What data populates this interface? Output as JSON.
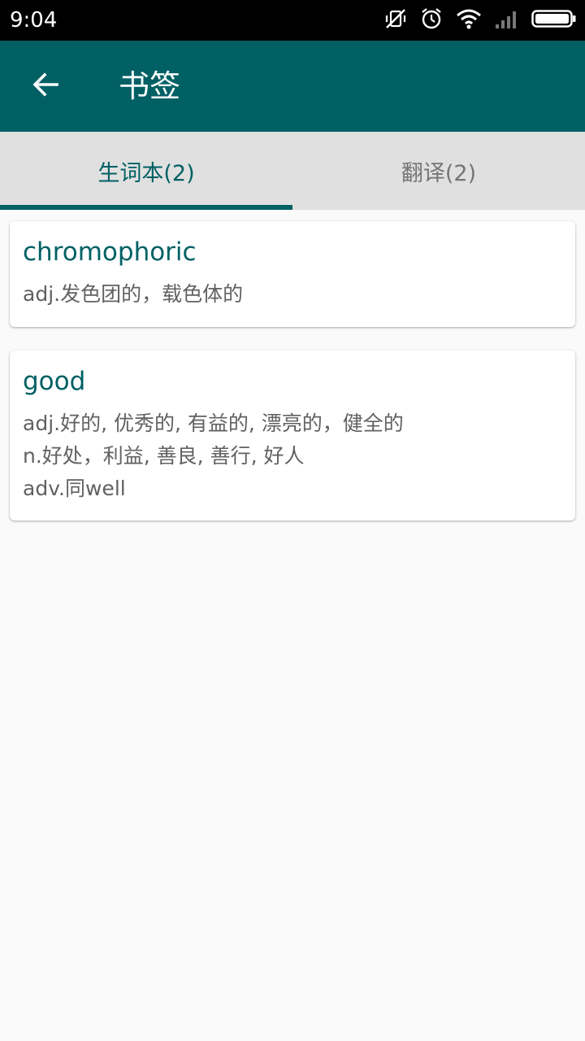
{
  "status_bar": {
    "time": "9:04",
    "icons": [
      "mute-vibrate-icon",
      "alarm-icon",
      "wifi-icon",
      "signal-icon",
      "battery-icon"
    ]
  },
  "app_bar": {
    "back_icon": "arrow-back-icon",
    "title": "书签",
    "color": "#006064"
  },
  "tabs": [
    {
      "label": "生词本(2)",
      "selected": true
    },
    {
      "label": "翻译(2)",
      "selected": false
    }
  ],
  "words": [
    {
      "word": "chromophoric",
      "definitions": [
        "adj.发色团的，载色体的"
      ]
    },
    {
      "word": "good",
      "definitions": [
        "adj.好的, 优秀的, 有益的, 漂亮的，健全的",
        "n.好处，利益, 善良, 善行, 好人",
        "adv.同well"
      ]
    }
  ]
}
